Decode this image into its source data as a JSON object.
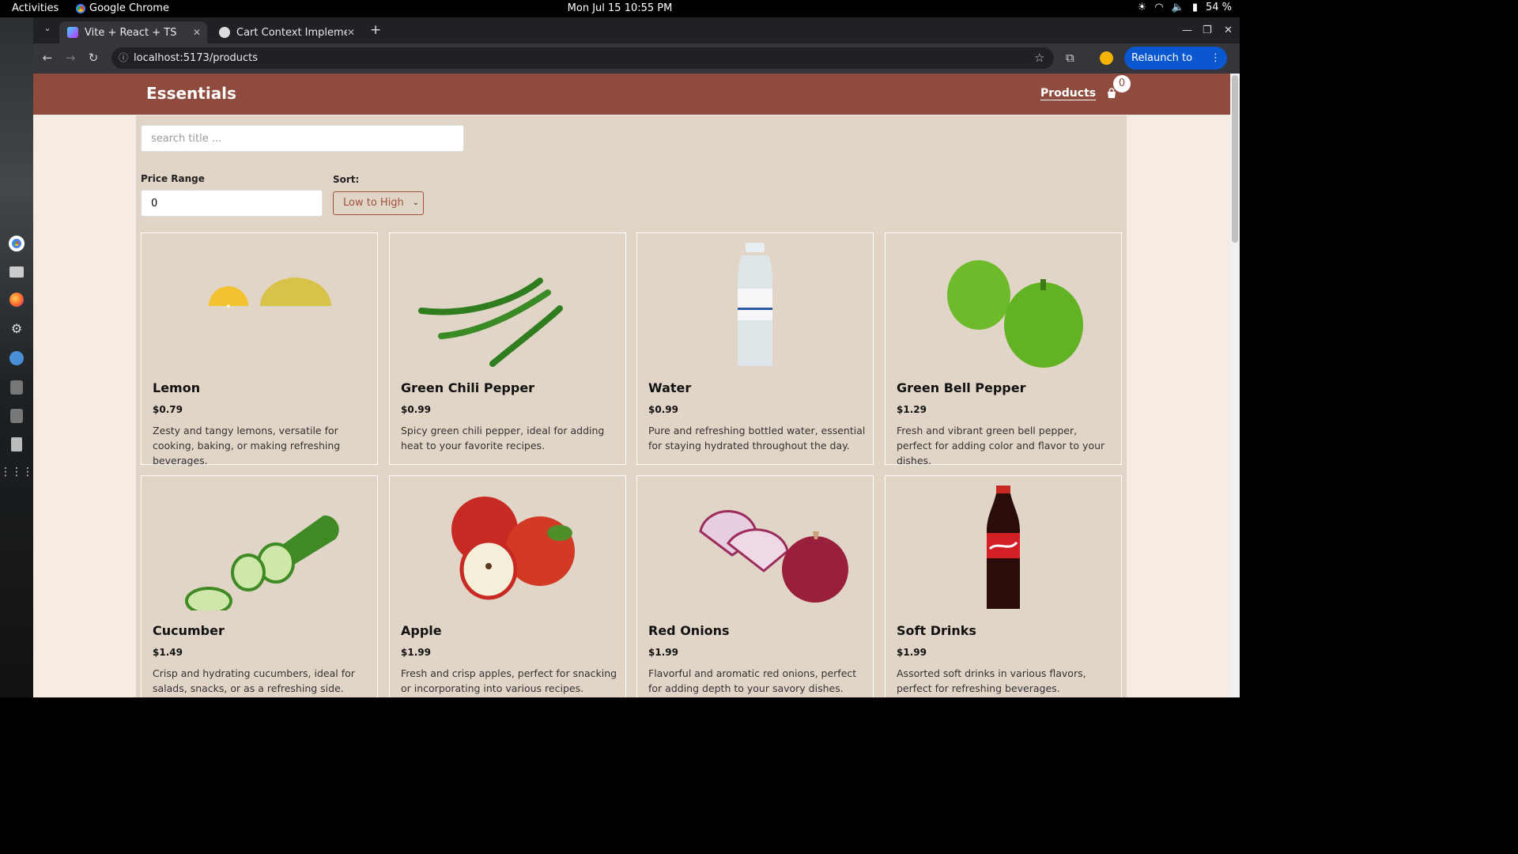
{
  "system": {
    "activities": "Activities",
    "app_name": "Google Chrome",
    "clock": "Mon Jul 15  10:55 PM",
    "battery": "54 %"
  },
  "browser": {
    "tabs": [
      {
        "label": "Vite + React + TS",
        "active": true
      },
      {
        "label": "Cart Context Implement",
        "active": false
      }
    ],
    "url": "localhost:5173/products",
    "relaunch_label": "Relaunch to update"
  },
  "site": {
    "brand": "Essentials",
    "nav_products": "Products",
    "cart_count": "0",
    "colors": {
      "nav": "#8f4b3d",
      "page": "#f7ece3",
      "content": "#e1d5c7"
    }
  },
  "filters": {
    "search_placeholder": "search title ...",
    "price_label": "Price Range",
    "price_value": "0",
    "sort_label": "Sort:",
    "sort_value": "Low to High"
  },
  "products": [
    {
      "title": "Lemon",
      "price": "$0.79",
      "description": "Zesty and tangy lemons, versatile for cooking, baking, or making refreshing beverages."
    },
    {
      "title": "Green Chili Pepper",
      "price": "$0.99",
      "description": "Spicy green chili pepper, ideal for adding heat to your favorite recipes."
    },
    {
      "title": "Water",
      "price": "$0.99",
      "description": "Pure and refreshing bottled water, essential for staying hydrated throughout the day."
    },
    {
      "title": "Green Bell Pepper",
      "price": "$1.29",
      "description": "Fresh and vibrant green bell pepper, perfect for adding color and flavor to your dishes."
    },
    {
      "title": "Cucumber",
      "price": "$1.49",
      "description": "Crisp and hydrating cucumbers, ideal for salads, snacks, or as a refreshing side."
    },
    {
      "title": "Apple",
      "price": "$1.99",
      "description": "Fresh and crisp apples, perfect for snacking or incorporating into various recipes."
    },
    {
      "title": "Red Onions",
      "price": "$1.99",
      "description": "Flavorful and aromatic red onions, perfect for adding depth to your savory dishes."
    },
    {
      "title": "Soft Drinks",
      "price": "$1.99",
      "description": "Assorted soft drinks in various flavors, perfect for refreshing beverages."
    }
  ]
}
